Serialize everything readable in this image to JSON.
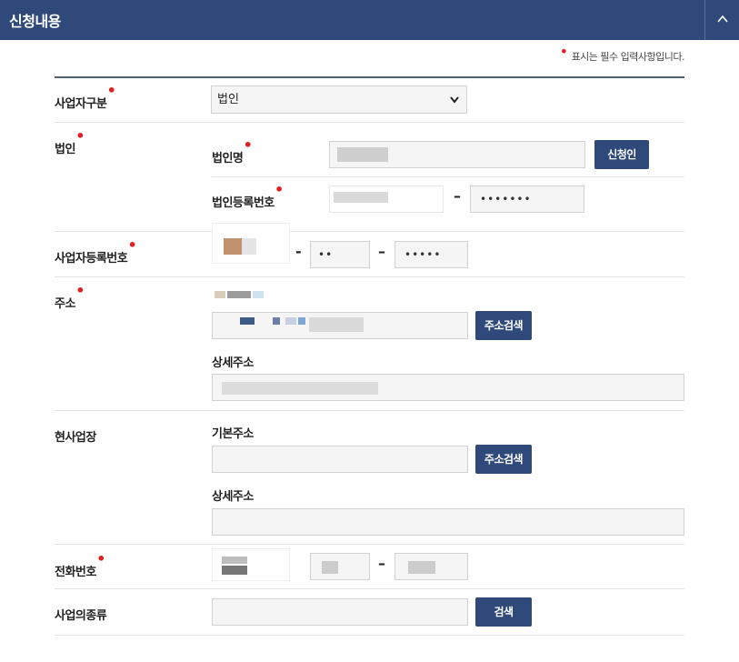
{
  "header": {
    "title": "신청내용",
    "collapse_icon": "chevron-up-icon"
  },
  "notice": {
    "text": "표시는 필수 입력사항입니다."
  },
  "business_type": {
    "label": "사업자구분",
    "selected": "법인"
  },
  "corporation": {
    "label": "법인",
    "name_label": "법인명",
    "applicant_button": "신청인",
    "reg_no_label": "법인등록번호",
    "reg_no_masked": "•••••••"
  },
  "business_reg": {
    "label": "사업자등록번호",
    "middle": "••",
    "last": "•••••"
  },
  "address": {
    "label": "주소",
    "search_button": "주소검색",
    "detail_label": "상세주소"
  },
  "worksite": {
    "label": "현사업장",
    "basic_label": "기본주소",
    "search_button": "주소검색",
    "detail_label": "상세주소"
  },
  "phone": {
    "label": "전화번호"
  },
  "business_kind": {
    "label": "사업의종류",
    "search_button": "검색"
  },
  "colors": {
    "header": "#2f4a7a",
    "required": "#e02020",
    "button": "#2f4a7a"
  }
}
